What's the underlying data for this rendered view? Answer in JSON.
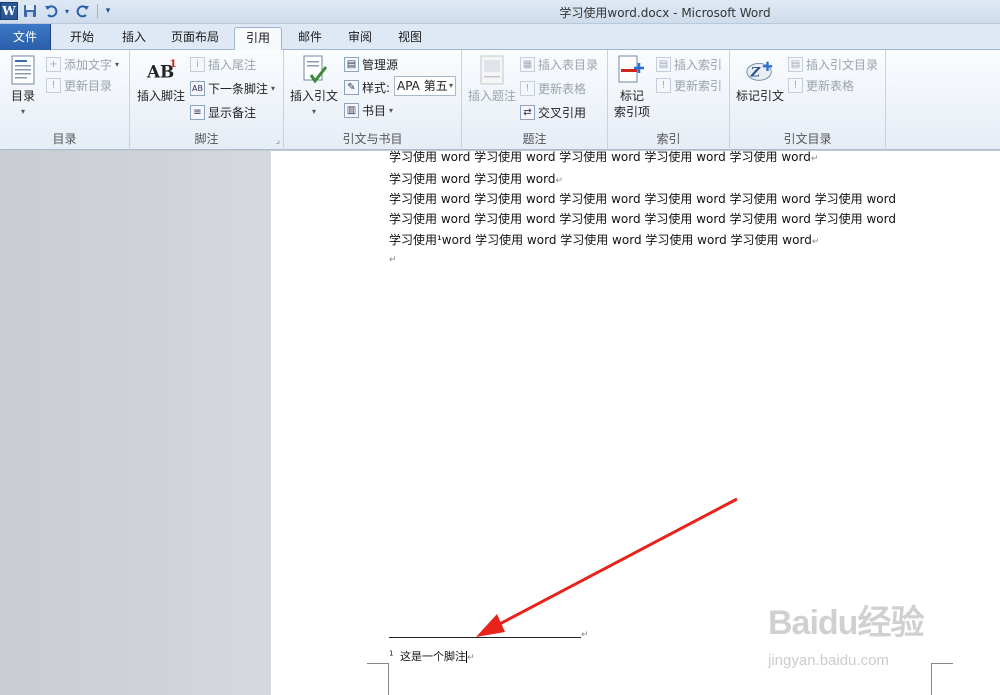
{
  "window": {
    "title": "学习使用word.docx - Microsoft Word"
  },
  "qat": {
    "logo": "W"
  },
  "tabs": {
    "file": "文件",
    "home": "开始",
    "insert": "插入",
    "layout": "页面布局",
    "references": "引用",
    "mailings": "邮件",
    "review": "审阅",
    "view": "视图"
  },
  "ribbon": {
    "toc": {
      "label": "目录",
      "toc_button": "目录",
      "add_text": "添加文字",
      "update_toc": "更新目录"
    },
    "footnotes": {
      "label": "脚注",
      "insert_footnote": "插入脚注",
      "insert_endnote": "插入尾注",
      "next_footnote": "下一条脚注",
      "show_notes": "显示备注"
    },
    "citations": {
      "label": "引文与书目",
      "insert_citation": "插入引文",
      "manage_sources": "管理源",
      "style_label": "样式:",
      "style_value": "APA 第五",
      "bibliography": "书目"
    },
    "captions": {
      "label": "题注",
      "insert_caption": "插入题注",
      "insert_table_of_figures": "插入表目录",
      "update_table": "更新表格",
      "cross_reference": "交叉引用"
    },
    "index": {
      "label": "索引",
      "mark_entry_line1": "标记",
      "mark_entry_line2": "索引项",
      "insert_index": "插入索引",
      "update_index": "更新索引"
    },
    "authorities": {
      "label": "引文目录",
      "mark_citation": "标记引文",
      "insert_toa": "插入引文目录",
      "update_table": "更新表格"
    }
  },
  "document": {
    "lines": [
      "学习使用 word 学习使用 word 学习使用 word 学习使用 word 学习使用 word",
      "学习使用 word 学习使用 word",
      "学习使用 word 学习使用 word 学习使用 word 学习使用 word 学习使用 word 学习使用 word",
      "学习使用 word 学习使用 word 学习使用 word 学习使用 word 学习使用 word 学习使用 word",
      "学习使用¹word 学习使用 word 学习使用 word 学习使用 word 学习使用 word"
    ],
    "footnote_number": "1",
    "footnote_text": "这是一个脚注"
  },
  "watermark": {
    "logo": "Baidu经验",
    "url": "jingyan.baidu.com"
  },
  "colors": {
    "file_tab": "#2a5faa",
    "arrow": "#e8231c",
    "ribbon_bg": "#eef3f9"
  }
}
